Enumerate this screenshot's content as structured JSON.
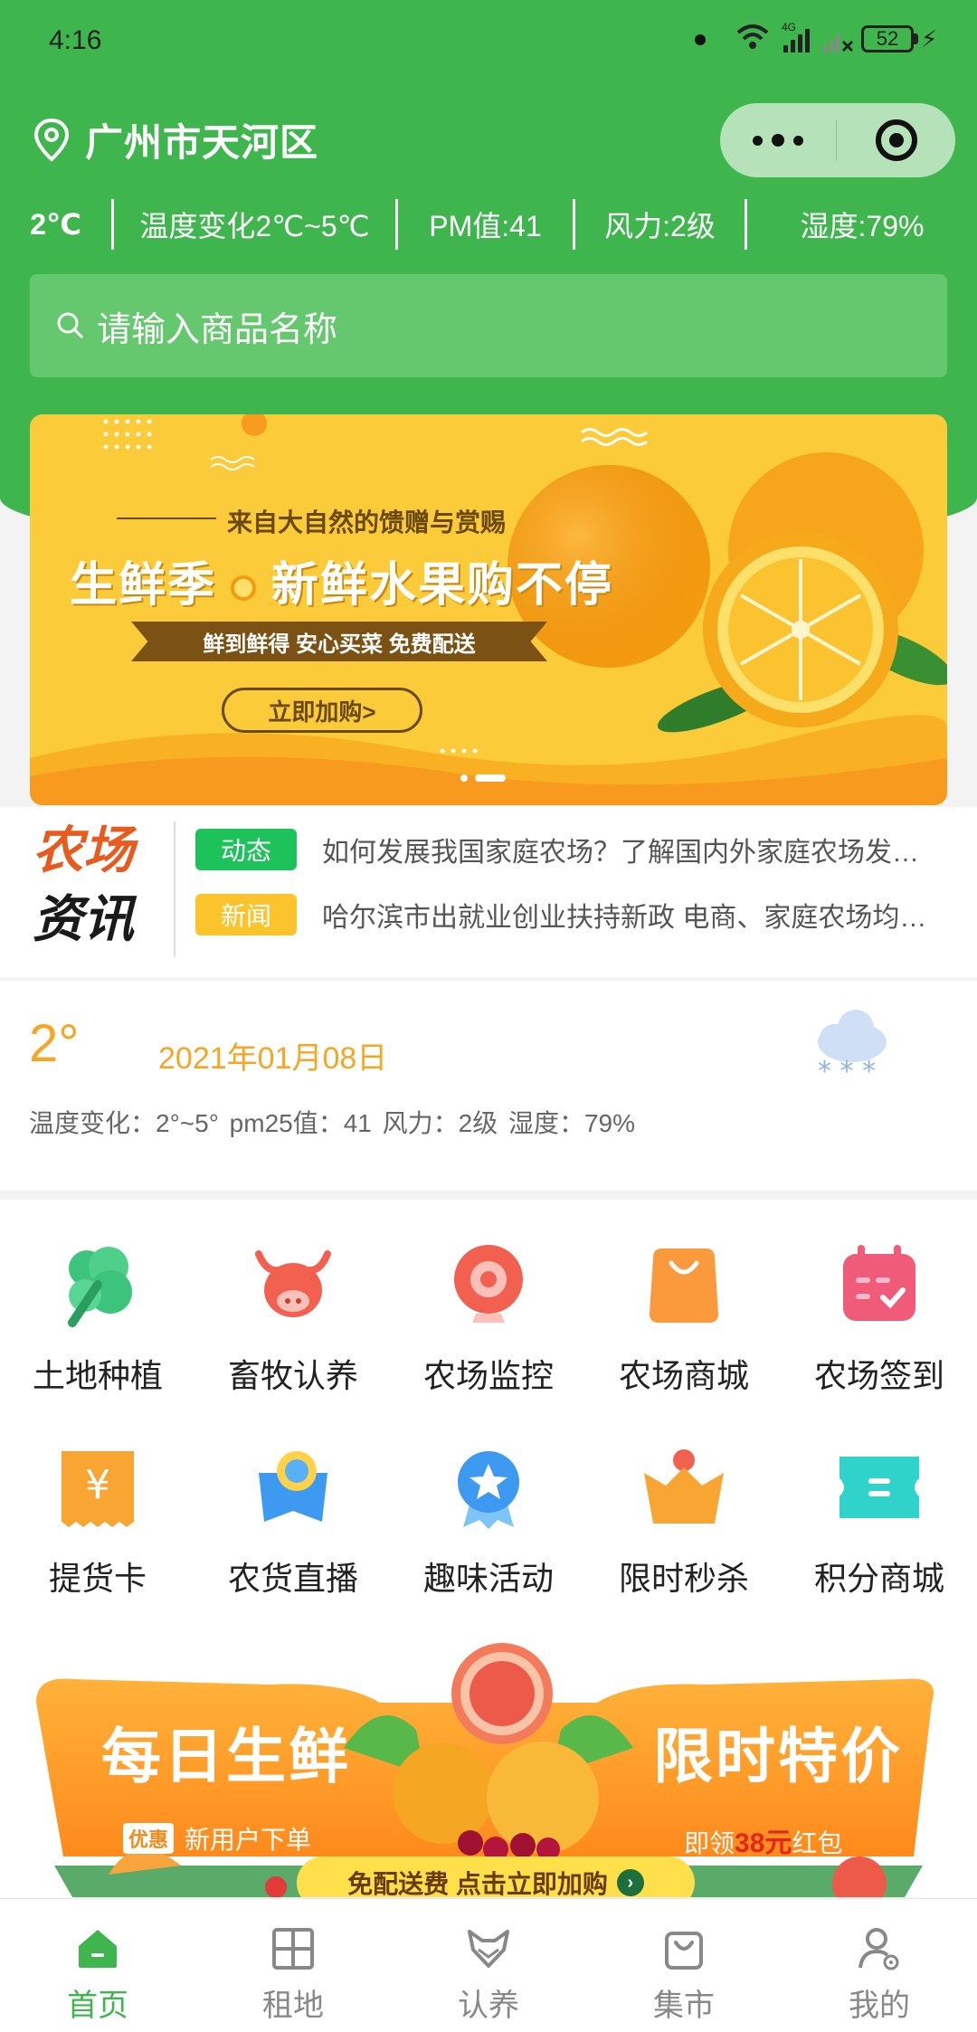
{
  "status_bar": {
    "time": "4:16",
    "network": "4G",
    "battery": "52"
  },
  "location": {
    "city": "广州市天河区"
  },
  "weather_strip": [
    "2℃",
    "温度变化2℃~5℃",
    "PM值:41",
    "风力:2级",
    "湿度:79%"
  ],
  "search": {
    "placeholder": "请输入商品名称"
  },
  "banner": {
    "subtitle": "来自大自然的馈赠与赏赐",
    "headline_a": "生鲜季",
    "headline_b": "新鲜水果购不停",
    "ribbon": "鲜到鲜得 安心买菜 免费配送",
    "button": "立即加购>",
    "slide_count": 2,
    "active_slide": 2
  },
  "news": {
    "logo_line1": "农场",
    "logo_line2": "资讯",
    "items": [
      {
        "tag": "动态",
        "tag_color": "#1ec25b",
        "text": "如何发展我国家庭农场？了解国内外家庭农场发展情况"
      },
      {
        "tag": "新闻",
        "tag_color": "#fbc42d",
        "text": "哈尔滨市出就业创业扶持新政 电商、家庭农场均有补贴"
      }
    ]
  },
  "weather_card": {
    "temp": "2°",
    "date": "2021年01月08日",
    "detail": "温度变化：2°~5°  pm25值：41  风力：2级  湿度：79%",
    "icon": "snow-cloud-icon"
  },
  "features": [
    {
      "label": "土地种植",
      "icon": "vegetable-icon"
    },
    {
      "label": "畜牧认养",
      "icon": "ox-icon"
    },
    {
      "label": "农场监控",
      "icon": "camera-icon"
    },
    {
      "label": "农场商城",
      "icon": "shopping-bag-icon"
    },
    {
      "label": "农场签到",
      "icon": "calendar-icon"
    },
    {
      "label": "提货卡",
      "icon": "yuan-card-icon"
    },
    {
      "label": "农货直播",
      "icon": "live-icon"
    },
    {
      "label": "趣味活动",
      "icon": "star-badge-icon"
    },
    {
      "label": "限时秒杀",
      "icon": "crown-icon"
    },
    {
      "label": "积分商城",
      "icon": "ticket-icon"
    }
  ],
  "promo": {
    "left_title": "每日生鲜",
    "right_title": "限时特价",
    "badge": "优惠",
    "left_sub": "新用户下单",
    "right_sub_a": "即领",
    "right_sub_b": "38元",
    "right_sub_c": "红包",
    "cta": "免配送费 点击立即加购"
  },
  "tabbar": [
    {
      "label": "首页",
      "icon": "home-icon",
      "active": true
    },
    {
      "label": "租地",
      "icon": "grid-icon",
      "active": false
    },
    {
      "label": "认养",
      "icon": "fox-icon",
      "active": false
    },
    {
      "label": "集市",
      "icon": "bag-icon",
      "active": false
    },
    {
      "label": "我的",
      "icon": "user-icon",
      "active": false
    }
  ],
  "colors": {
    "brand": "#3fb54e",
    "accent": "#f5a623",
    "banner_bg": "#fbcb3a"
  }
}
